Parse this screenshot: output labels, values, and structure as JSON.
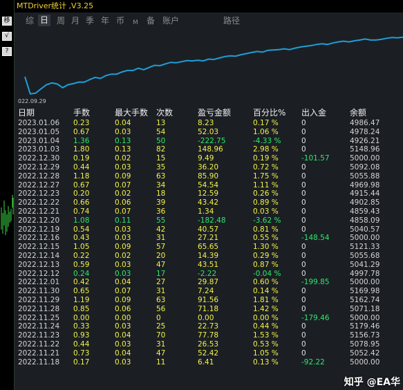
{
  "window": {
    "title": "MTDriver统计 ,V3.25"
  },
  "left_buttons": [
    "移",
    "√",
    "?"
  ],
  "tabs": [
    {
      "label": "综",
      "active": false
    },
    {
      "label": "日",
      "active": true
    },
    {
      "label": "周",
      "active": false
    },
    {
      "label": "月",
      "active": false
    },
    {
      "label": "季",
      "active": false
    },
    {
      "label": "年",
      "active": false
    },
    {
      "label": "币",
      "active": false
    },
    {
      "label": "M",
      "active": false
    },
    {
      "label": "备",
      "active": false
    },
    {
      "label": "账户",
      "active": false
    },
    {
      "label": "路径",
      "active": false
    }
  ],
  "chart_data": {
    "type": "line",
    "x_label_visible": "022.09.29",
    "line_color": "#1e9fd8",
    "values": [
      0.55,
      0.08,
      0.1,
      0.22,
      0.33,
      0.38,
      0.35,
      0.25,
      0.33,
      0.36,
      0.4,
      0.4,
      0.47,
      0.53,
      0.5,
      0.58,
      0.62,
      0.62,
      0.68,
      0.72,
      0.72,
      0.78,
      0.74,
      0.8,
      0.86,
      0.85,
      0.9,
      0.94,
      0.93,
      0.96,
      0.99,
      0.98,
      1.0,
      0.98,
      1.03,
      1.02,
      1.06,
      1.1,
      1.12,
      1.11,
      1.15,
      1.18,
      1.21,
      1.24,
      1.22,
      1.27,
      1.28,
      1.29,
      1.31,
      1.29,
      1.33,
      1.36,
      1.38,
      1.4,
      1.43,
      1.45,
      1.43,
      1.47,
      1.5,
      1.52,
      1.5,
      1.53,
      1.55,
      1.58,
      1.55,
      1.55,
      1.57,
      1.6,
      1.62,
      1.61,
      1.63
    ]
  },
  "table": {
    "headers": {
      "date": "日期",
      "lots": "手数",
      "max_lots": "最大手数",
      "count": "次数",
      "pnl": "盈亏金额",
      "pct": "百分比%",
      "io": "出入金",
      "balance": "余额"
    },
    "rows": [
      {
        "date": "2023.01.06",
        "lots": "0.23",
        "max_lots": "0.04",
        "count": "13",
        "pnl": "8.23",
        "pct": "0.17 %",
        "io": "0",
        "balance": "4986.47",
        "tone": "y"
      },
      {
        "date": "2023.01.05",
        "lots": "0.67",
        "max_lots": "0.03",
        "count": "54",
        "pnl": "52.03",
        "pct": "1.06 %",
        "io": "0",
        "balance": "4978.24",
        "tone": "y"
      },
      {
        "date": "2023.01.04",
        "lots": "1.36",
        "max_lots": "0.13",
        "count": "50",
        "pnl": "-222.75",
        "pct": "-4.33 %",
        "io": "0",
        "balance": "4926.21",
        "tone": "g"
      },
      {
        "date": "2023.01.03",
        "lots": "1.80",
        "max_lots": "0.13",
        "count": "82",
        "pnl": "148.96",
        "pct": "2.98 %",
        "io": "0",
        "balance": "5148.96",
        "tone": "y"
      },
      {
        "date": "2022.12.30",
        "lots": "0.19",
        "max_lots": "0.02",
        "count": "15",
        "pnl": "9.49",
        "pct": "0.19 %",
        "io": "-101.57",
        "balance": "5000.00",
        "tone": "y"
      },
      {
        "date": "2022.12.29",
        "lots": "0.44",
        "max_lots": "0.03",
        "count": "35",
        "pnl": "36.20",
        "pct": "0.72 %",
        "io": "0",
        "balance": "5092.08",
        "tone": "y"
      },
      {
        "date": "2022.12.28",
        "lots": "1.18",
        "max_lots": "0.09",
        "count": "63",
        "pnl": "85.90",
        "pct": "1.75 %",
        "io": "0",
        "balance": "5055.88",
        "tone": "y"
      },
      {
        "date": "2022.12.27",
        "lots": "0.67",
        "max_lots": "0.07",
        "count": "34",
        "pnl": "54.54",
        "pct": "1.11 %",
        "io": "0",
        "balance": "4969.98",
        "tone": "y"
      },
      {
        "date": "2022.12.23",
        "lots": "0.20",
        "max_lots": "0.02",
        "count": "18",
        "pnl": "12.59",
        "pct": "0.26 %",
        "io": "0",
        "balance": "4915.44",
        "tone": "y"
      },
      {
        "date": "2022.12.22",
        "lots": "0.66",
        "max_lots": "0.06",
        "count": "39",
        "pnl": "43.42",
        "pct": "0.89 %",
        "io": "0",
        "balance": "4902.85",
        "tone": "y"
      },
      {
        "date": "2022.12.21",
        "lots": "0.74",
        "max_lots": "0.07",
        "count": "36",
        "pnl": "1.34",
        "pct": "0.03 %",
        "io": "0",
        "balance": "4859.43",
        "tone": "y"
      },
      {
        "date": "2022.12.20",
        "lots": "1.08",
        "max_lots": "0.11",
        "count": "55",
        "pnl": "-182.48",
        "pct": "-3.62 %",
        "io": "0",
        "balance": "4858.09",
        "tone": "g"
      },
      {
        "date": "2022.12.19",
        "lots": "0.54",
        "max_lots": "0.03",
        "count": "42",
        "pnl": "40.57",
        "pct": "0.81 %",
        "io": "0",
        "balance": "5040.57",
        "tone": "y"
      },
      {
        "date": "2022.12.16",
        "lots": "0.43",
        "max_lots": "0.03",
        "count": "31",
        "pnl": "27.21",
        "pct": "0.55 %",
        "io": "-148.54",
        "balance": "5000.00",
        "tone": "y"
      },
      {
        "date": "2022.12.15",
        "lots": "1.05",
        "max_lots": "0.09",
        "count": "57",
        "pnl": "65.65",
        "pct": "1.30 %",
        "io": "0",
        "balance": "5121.33",
        "tone": "y"
      },
      {
        "date": "2022.12.14",
        "lots": "0.22",
        "max_lots": "0.02",
        "count": "20",
        "pnl": "14.39",
        "pct": "0.29 %",
        "io": "0",
        "balance": "5055.68",
        "tone": "y"
      },
      {
        "date": "2022.12.13",
        "lots": "0.59",
        "max_lots": "0.03",
        "count": "47",
        "pnl": "43.51",
        "pct": "0.87 %",
        "io": "0",
        "balance": "5041.29",
        "tone": "y"
      },
      {
        "date": "2022.12.12",
        "lots": "0.24",
        "max_lots": "0.03",
        "count": "17",
        "pnl": "-2.22",
        "pct": "-0.04 %",
        "io": "0",
        "balance": "4997.78",
        "tone": "g"
      },
      {
        "date": "2022.12.01",
        "lots": "0.42",
        "max_lots": "0.04",
        "count": "27",
        "pnl": "29.87",
        "pct": "0.60 %",
        "io": "-199.85",
        "balance": "5000.00",
        "tone": "y"
      },
      {
        "date": "2022.11.30",
        "lots": "0.65",
        "max_lots": "0.07",
        "count": "31",
        "pnl": "7.24",
        "pct": "0.14 %",
        "io": "0",
        "balance": "5169.98",
        "tone": "y"
      },
      {
        "date": "2022.11.29",
        "lots": "1.19",
        "max_lots": "0.09",
        "count": "63",
        "pnl": "91.56",
        "pct": "1.81 %",
        "io": "0",
        "balance": "5162.74",
        "tone": "y"
      },
      {
        "date": "2022.11.28",
        "lots": "0.85",
        "max_lots": "0.06",
        "count": "56",
        "pnl": "71.18",
        "pct": "1.42 %",
        "io": "0",
        "balance": "5071.18",
        "tone": "y"
      },
      {
        "date": "2022.11.25",
        "lots": "0.00",
        "max_lots": "0.00",
        "count": "0",
        "pnl": "0.00",
        "pct": "0.00 %",
        "io": "-179.46",
        "balance": "5000.00",
        "tone": "y"
      },
      {
        "date": "2022.11.24",
        "lots": "0.33",
        "max_lots": "0.03",
        "count": "25",
        "pnl": "22.73",
        "pct": "0.44 %",
        "io": "0",
        "balance": "5179.46",
        "tone": "y"
      },
      {
        "date": "2022.11.23",
        "lots": "0.93",
        "max_lots": "0.04",
        "count": "70",
        "pnl": "77.78",
        "pct": "1.53 %",
        "io": "0",
        "balance": "5156.73",
        "tone": "y"
      },
      {
        "date": "2022.11.22",
        "lots": "0.44",
        "max_lots": "0.03",
        "count": "31",
        "pnl": "26.53",
        "pct": "0.53 %",
        "io": "0",
        "balance": "5078.95",
        "tone": "y"
      },
      {
        "date": "2022.11.21",
        "lots": "0.73",
        "max_lots": "0.04",
        "count": "47",
        "pnl": "52.42",
        "pct": "1.05 %",
        "io": "0",
        "balance": "5052.42",
        "tone": "y"
      },
      {
        "date": "2022.11.18",
        "lots": "0.17",
        "max_lots": "0.03",
        "count": "11",
        "pnl": "6.41",
        "pct": "0.13 %",
        "io": "-92.22",
        "balance": "5000.00",
        "tone": "y"
      }
    ]
  },
  "watermark": "知乎 @EA华"
}
